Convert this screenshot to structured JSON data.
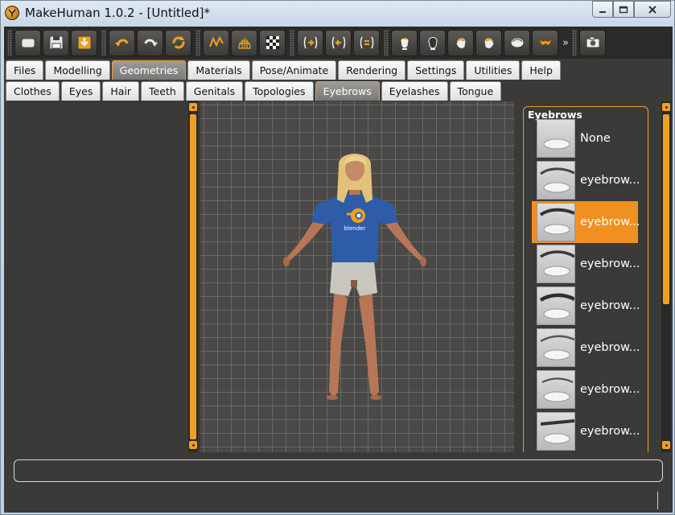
{
  "window": {
    "title": "MakeHuman 1.0.2 - [Untitled]*",
    "minimize_glyph": "—",
    "maximize_glyph": "▢",
    "close_glyph": "✕"
  },
  "toolbar": {
    "buttons": [
      {
        "icon": "new-icon"
      },
      {
        "icon": "save-icon"
      },
      {
        "icon": "export-icon"
      },
      {
        "icon": "undo-icon"
      },
      {
        "icon": "redo-icon"
      },
      {
        "icon": "reset-icon"
      },
      {
        "icon": "smooth-icon"
      },
      {
        "icon": "wireframe-icon"
      },
      {
        "icon": "background-icon"
      },
      {
        "icon": "front-view-icon"
      },
      {
        "icon": "back-view-icon"
      },
      {
        "icon": "left-view-icon"
      },
      {
        "icon": "head-front-icon"
      },
      {
        "icon": "head-back-icon"
      },
      {
        "icon": "head-left-icon"
      },
      {
        "icon": "head-right-icon"
      },
      {
        "icon": "head-top-icon"
      },
      {
        "icon": "head-bottom-icon"
      },
      {
        "icon": "camera-icon"
      }
    ],
    "more_glyph": "»"
  },
  "tabs": [
    "Files",
    "Modelling",
    "Geometries",
    "Materials",
    "Pose/Animate",
    "Rendering",
    "Settings",
    "Utilities",
    "Help"
  ],
  "active_tab": "Geometries",
  "subtabs": [
    "Clothes",
    "Eyes",
    "Hair",
    "Teeth",
    "Genitals",
    "Topologies",
    "Eyebrows",
    "Eyelashes",
    "Tongue"
  ],
  "active_subtab": "Eyebrows",
  "eyebrows": {
    "title": "Eyebrows",
    "items": [
      "None",
      "eyebrow...",
      "eyebrow...",
      "eyebrow...",
      "eyebrow...",
      "eyebrow...",
      "eyebrow...",
      "eyebrow..."
    ],
    "selected_index": 2
  },
  "model_shirt_text": "blender",
  "colors": {
    "accent": "#f0a020",
    "panel": "#3b3a38",
    "shirt": "#2f5ca8"
  }
}
